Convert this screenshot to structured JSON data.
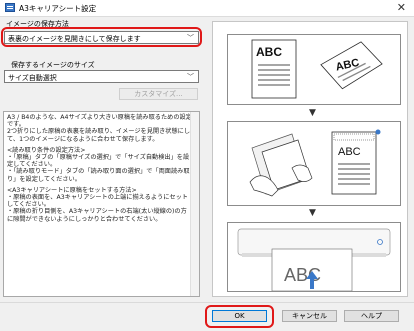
{
  "window": {
    "title": "A3キャリアシート設定",
    "close_glyph": "✕"
  },
  "save_method": {
    "label": "イメージの保存方法",
    "value": "表裏のイメージを見開きにして保存します"
  },
  "save_size": {
    "label": "保存するイメージのサイズ",
    "value": "サイズ自動選択",
    "custom_button": "カスタマイズ..."
  },
  "description": {
    "paragraphs": [
      "A3 / B4のような、A4サイズより大きい原稿を読み取るための設定です。\n2つ折りにした原稿の表裏を読み取り、イメージを見開き状態にして、1つのイメージになるように合わせて保存します。",
      "<読み取り条件の設定方法>\n・「原稿」タブの「原稿サイズの選択」で「サイズ自動検出」を設定してください。\n・「読み取りモード」タブの「読み取り面の選択」で「両面読み取り」を設定してください。",
      "<A3キャリアシートに原稿をセットする方法>\n・原稿の表面を、A3キャリアシートの上端に揃えるようにセットしてください。\n・原稿の折り目側を、A3キャリアシートの右端(太い縦線の)の方に隙間ができないようにしっかりと合わせてください。"
    ]
  },
  "illustration": {
    "abc_text": "ABC",
    "arrow_glyph": "▼"
  },
  "buttons": {
    "ok": "OK",
    "cancel": "キャンセル",
    "help": "ヘルプ"
  }
}
